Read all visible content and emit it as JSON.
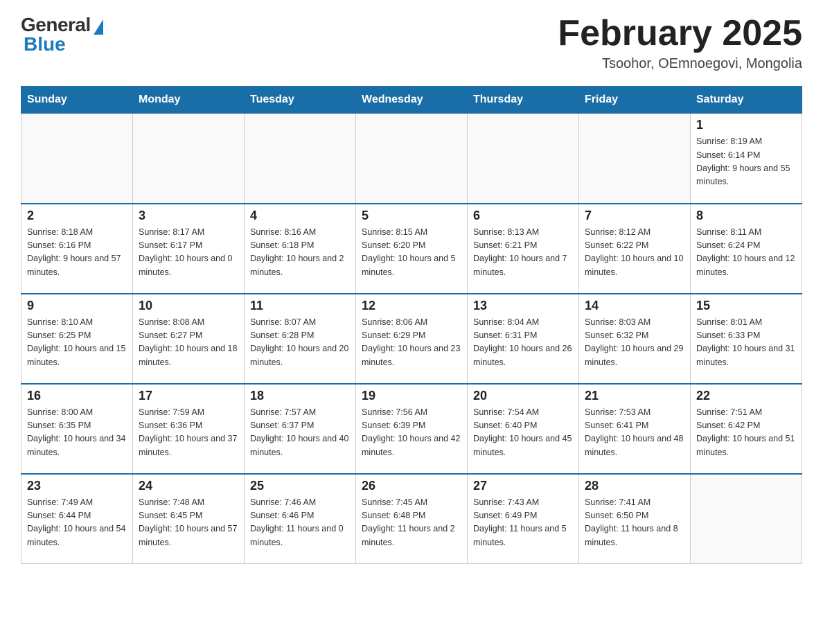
{
  "header": {
    "logo_general": "General",
    "logo_blue": "Blue",
    "month_title": "February 2025",
    "location": "Tsoohor, OEmnoegovi, Mongolia"
  },
  "days_of_week": [
    "Sunday",
    "Monday",
    "Tuesday",
    "Wednesday",
    "Thursday",
    "Friday",
    "Saturday"
  ],
  "weeks": [
    [
      {
        "day": "",
        "info": ""
      },
      {
        "day": "",
        "info": ""
      },
      {
        "day": "",
        "info": ""
      },
      {
        "day": "",
        "info": ""
      },
      {
        "day": "",
        "info": ""
      },
      {
        "day": "",
        "info": ""
      },
      {
        "day": "1",
        "info": "Sunrise: 8:19 AM\nSunset: 6:14 PM\nDaylight: 9 hours and 55 minutes."
      }
    ],
    [
      {
        "day": "2",
        "info": "Sunrise: 8:18 AM\nSunset: 6:16 PM\nDaylight: 9 hours and 57 minutes."
      },
      {
        "day": "3",
        "info": "Sunrise: 8:17 AM\nSunset: 6:17 PM\nDaylight: 10 hours and 0 minutes."
      },
      {
        "day": "4",
        "info": "Sunrise: 8:16 AM\nSunset: 6:18 PM\nDaylight: 10 hours and 2 minutes."
      },
      {
        "day": "5",
        "info": "Sunrise: 8:15 AM\nSunset: 6:20 PM\nDaylight: 10 hours and 5 minutes."
      },
      {
        "day": "6",
        "info": "Sunrise: 8:13 AM\nSunset: 6:21 PM\nDaylight: 10 hours and 7 minutes."
      },
      {
        "day": "7",
        "info": "Sunrise: 8:12 AM\nSunset: 6:22 PM\nDaylight: 10 hours and 10 minutes."
      },
      {
        "day": "8",
        "info": "Sunrise: 8:11 AM\nSunset: 6:24 PM\nDaylight: 10 hours and 12 minutes."
      }
    ],
    [
      {
        "day": "9",
        "info": "Sunrise: 8:10 AM\nSunset: 6:25 PM\nDaylight: 10 hours and 15 minutes."
      },
      {
        "day": "10",
        "info": "Sunrise: 8:08 AM\nSunset: 6:27 PM\nDaylight: 10 hours and 18 minutes."
      },
      {
        "day": "11",
        "info": "Sunrise: 8:07 AM\nSunset: 6:28 PM\nDaylight: 10 hours and 20 minutes."
      },
      {
        "day": "12",
        "info": "Sunrise: 8:06 AM\nSunset: 6:29 PM\nDaylight: 10 hours and 23 minutes."
      },
      {
        "day": "13",
        "info": "Sunrise: 8:04 AM\nSunset: 6:31 PM\nDaylight: 10 hours and 26 minutes."
      },
      {
        "day": "14",
        "info": "Sunrise: 8:03 AM\nSunset: 6:32 PM\nDaylight: 10 hours and 29 minutes."
      },
      {
        "day": "15",
        "info": "Sunrise: 8:01 AM\nSunset: 6:33 PM\nDaylight: 10 hours and 31 minutes."
      }
    ],
    [
      {
        "day": "16",
        "info": "Sunrise: 8:00 AM\nSunset: 6:35 PM\nDaylight: 10 hours and 34 minutes."
      },
      {
        "day": "17",
        "info": "Sunrise: 7:59 AM\nSunset: 6:36 PM\nDaylight: 10 hours and 37 minutes."
      },
      {
        "day": "18",
        "info": "Sunrise: 7:57 AM\nSunset: 6:37 PM\nDaylight: 10 hours and 40 minutes."
      },
      {
        "day": "19",
        "info": "Sunrise: 7:56 AM\nSunset: 6:39 PM\nDaylight: 10 hours and 42 minutes."
      },
      {
        "day": "20",
        "info": "Sunrise: 7:54 AM\nSunset: 6:40 PM\nDaylight: 10 hours and 45 minutes."
      },
      {
        "day": "21",
        "info": "Sunrise: 7:53 AM\nSunset: 6:41 PM\nDaylight: 10 hours and 48 minutes."
      },
      {
        "day": "22",
        "info": "Sunrise: 7:51 AM\nSunset: 6:42 PM\nDaylight: 10 hours and 51 minutes."
      }
    ],
    [
      {
        "day": "23",
        "info": "Sunrise: 7:49 AM\nSunset: 6:44 PM\nDaylight: 10 hours and 54 minutes."
      },
      {
        "day": "24",
        "info": "Sunrise: 7:48 AM\nSunset: 6:45 PM\nDaylight: 10 hours and 57 minutes."
      },
      {
        "day": "25",
        "info": "Sunrise: 7:46 AM\nSunset: 6:46 PM\nDaylight: 11 hours and 0 minutes."
      },
      {
        "day": "26",
        "info": "Sunrise: 7:45 AM\nSunset: 6:48 PM\nDaylight: 11 hours and 2 minutes."
      },
      {
        "day": "27",
        "info": "Sunrise: 7:43 AM\nSunset: 6:49 PM\nDaylight: 11 hours and 5 minutes."
      },
      {
        "day": "28",
        "info": "Sunrise: 7:41 AM\nSunset: 6:50 PM\nDaylight: 11 hours and 8 minutes."
      },
      {
        "day": "",
        "info": ""
      }
    ]
  ]
}
